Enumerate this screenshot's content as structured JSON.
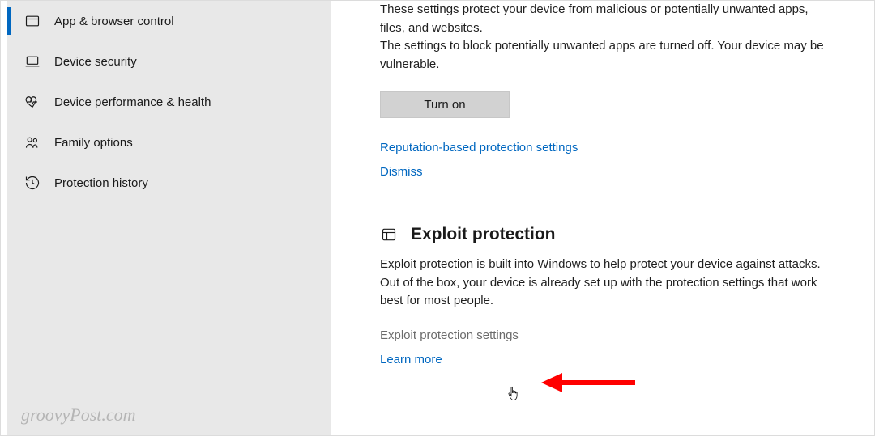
{
  "sidebar": {
    "items": [
      {
        "label": "App & browser control"
      },
      {
        "label": "Device security"
      },
      {
        "label": "Device performance & health"
      },
      {
        "label": "Family options"
      },
      {
        "label": "Protection history"
      }
    ]
  },
  "content": {
    "reputation": {
      "line1": "These settings protect your device from malicious or potentially unwanted apps, files, and websites.",
      "line2": "The settings to block potentially unwanted apps are turned off. Your device may be vulnerable.",
      "turn_on": "Turn on",
      "settings_link": "Reputation-based protection settings",
      "dismiss": "Dismiss"
    },
    "exploit": {
      "title": "Exploit protection",
      "desc": "Exploit protection is built into Windows to help protect your device against attacks.  Out of the box, your device is already set up with the protection settings that work best for most people.",
      "settings_link": "Exploit protection settings",
      "learn_more": "Learn more"
    }
  },
  "watermark": "groovyPost.com"
}
